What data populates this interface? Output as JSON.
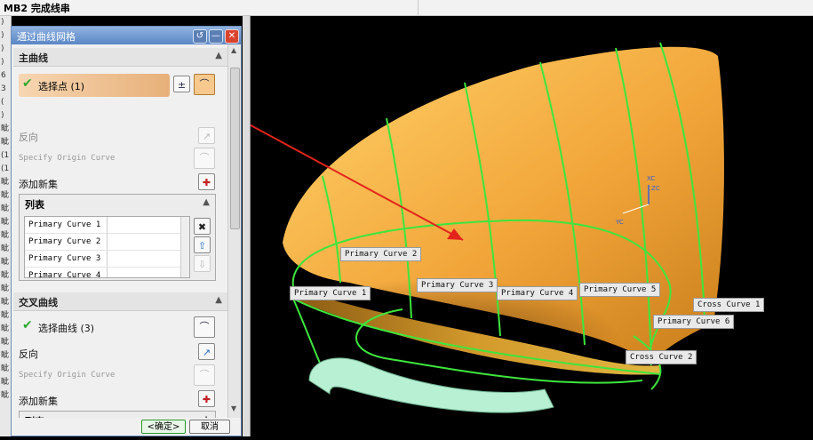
{
  "app": {
    "title": "MB2 完成线串"
  },
  "left_strip": {
    "chars": [
      ")",
      ")",
      ")",
      ")",
      "6",
      "3",
      "(",
      ")",
      "眦",
      "眦",
      "(1",
      "(1",
      "眦",
      "眦",
      "眦",
      "眦",
      "眦",
      "眦",
      "眦",
      "眦",
      "眦",
      "眦",
      "眦",
      "眦",
      "眦",
      "眦",
      "眦",
      "眦",
      "眦"
    ]
  },
  "dialog": {
    "title": "通过曲线网格",
    "title_buttons": {
      "reset": "↺",
      "minimize": "—",
      "close": "✕"
    },
    "primary": {
      "header": "主曲线",
      "select_label": "选择点 (1)",
      "reverse_label": "反向",
      "origin_label": "Specify Origin Curve",
      "add_set_label": "添加新集",
      "list_header": "列表",
      "rows": [
        "Primary Curve  1",
        "Primary Curve  2",
        "Primary Curve  3",
        "Primary Curve  4"
      ]
    },
    "cross": {
      "header": "交叉曲线",
      "select_label": "选择曲线 (3)",
      "reverse_label": "反向",
      "origin_label": "Specify Origin Curve",
      "add_set_label": "添加新集",
      "list_header": "列表"
    },
    "buttons": {
      "ok": "<确定>",
      "cancel": "取消"
    }
  },
  "viewport": {
    "axis_labels": {
      "xc": "XC",
      "zc": "ZC",
      "yc": "YC"
    },
    "labels": {
      "primary_1": "Primary Curve  1",
      "primary_2": "Primary Curve  2",
      "primary_3": "Primary Curve  3",
      "primary_4": "Primary Curve  4",
      "primary_5": "Primary Curve  5",
      "primary_6": "Primary Curve  6",
      "cross_1": "Cross Curve  1",
      "cross_2": "Cross Curve  2"
    },
    "colors": {
      "surface": "#f2a63a",
      "curve": "#3de63d",
      "arrow": "#e3241b",
      "tube": "#b8f0d4"
    }
  }
}
